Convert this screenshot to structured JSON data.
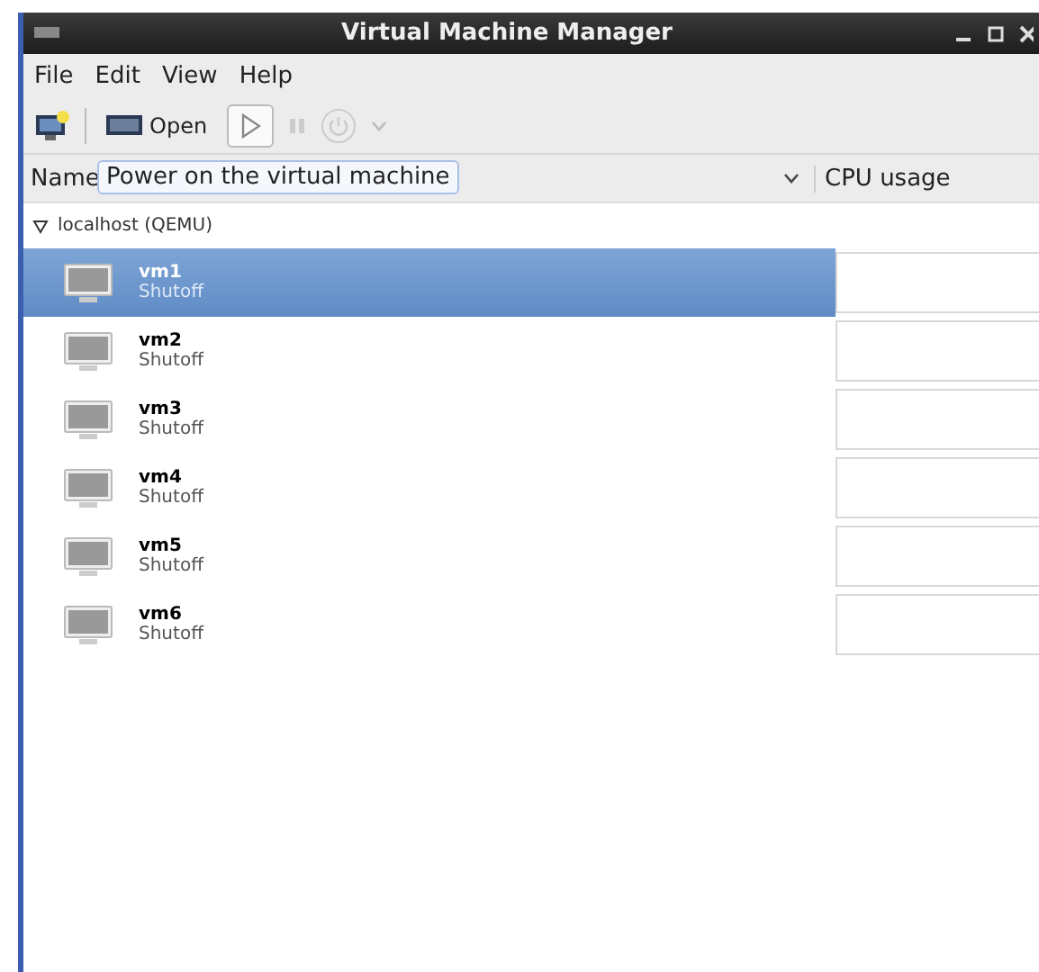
{
  "window": {
    "title": "Virtual Machine Manager"
  },
  "menu": [
    "File",
    "Edit",
    "View",
    "Help"
  ],
  "toolbar": {
    "open_label": "Open"
  },
  "tooltip": "Power on the virtual machine",
  "columns": [
    "Name",
    "CPU usage"
  ],
  "host": {
    "label": "localhost (QEMU)",
    "expanded": true
  },
  "vms": [
    {
      "name": "vm1",
      "status": "Shutoff",
      "selected": true
    },
    {
      "name": "vm2",
      "status": "Shutoff",
      "selected": false
    },
    {
      "name": "vm3",
      "status": "Shutoff",
      "selected": false
    },
    {
      "name": "vm4",
      "status": "Shutoff",
      "selected": false
    },
    {
      "name": "vm5",
      "status": "Shutoff",
      "selected": false
    },
    {
      "name": "vm6",
      "status": "Shutoff",
      "selected": false
    }
  ]
}
